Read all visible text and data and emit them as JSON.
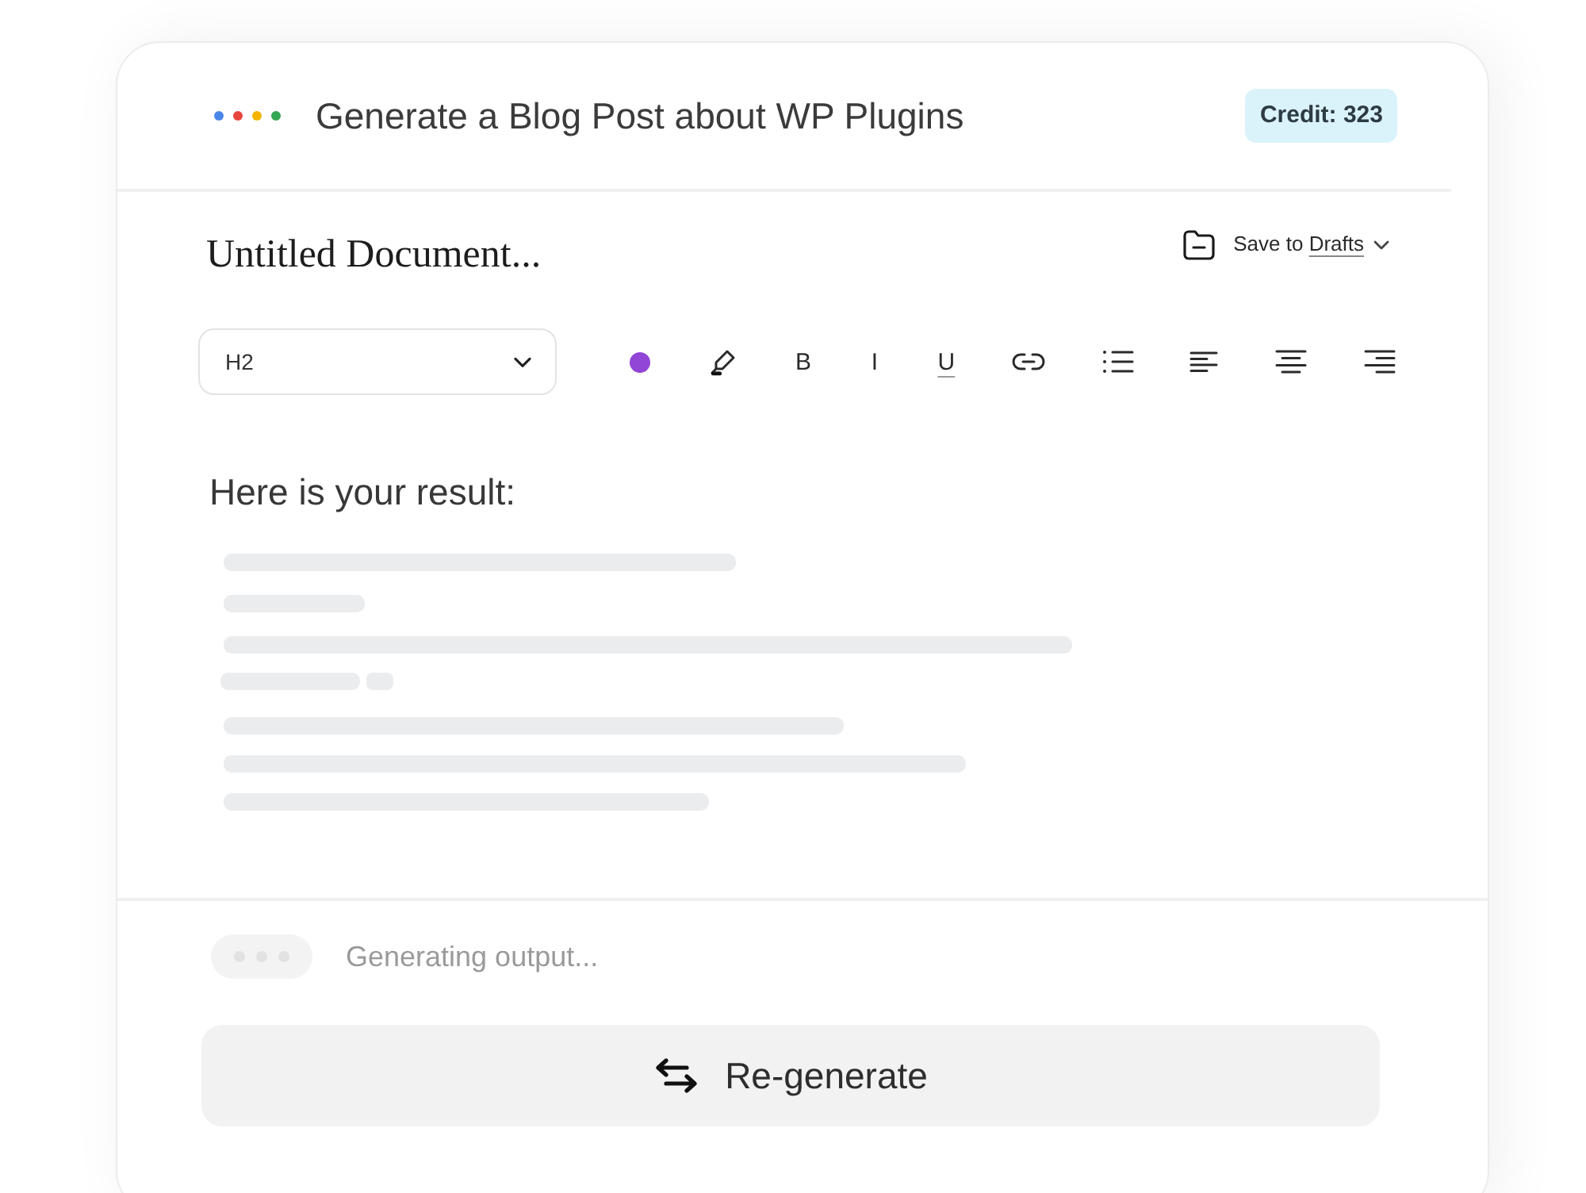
{
  "header": {
    "dots": [
      {
        "color": "#4a86e8"
      },
      {
        "color": "#e8453c"
      },
      {
        "color": "#f4b400"
      },
      {
        "color": "#34a853"
      }
    ],
    "title": "Generate a Blog Post about WP Plugins",
    "credit": "Credit: 323"
  },
  "document": {
    "title": "Untitled Document...",
    "save": {
      "label": "Save to",
      "target": "Drafts"
    }
  },
  "toolbar": {
    "heading_select": {
      "value": "H2"
    },
    "tools": [
      {
        "kind": "swatch",
        "color": "#9146d6"
      },
      {
        "kind": "highlight"
      },
      {
        "kind": "bold",
        "label": "B"
      },
      {
        "kind": "italic",
        "label": "I"
      },
      {
        "kind": "underline",
        "label": "U"
      },
      {
        "kind": "link"
      },
      {
        "kind": "bullets"
      },
      {
        "kind": "alignleft"
      },
      {
        "kind": "aligncenter"
      },
      {
        "kind": "alignright"
      }
    ]
  },
  "content": {
    "heading": "Here is your result:"
  },
  "status": {
    "text": "Generating output..."
  },
  "regenerate_button": {
    "label": "Re-generate"
  }
}
